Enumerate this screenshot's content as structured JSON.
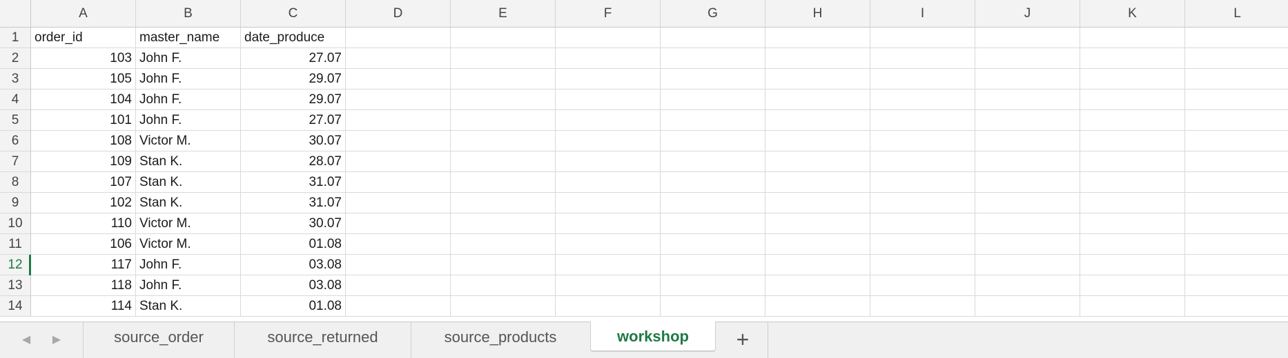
{
  "columns": [
    "A",
    "B",
    "C",
    "D",
    "E",
    "F",
    "G",
    "H",
    "I",
    "J",
    "K",
    "L"
  ],
  "rows": [
    {
      "n": "1",
      "a": "order_id",
      "b": "master_name",
      "c": "date_produce",
      "header": true
    },
    {
      "n": "2",
      "a": "103",
      "b": "John F.",
      "c": "27.07"
    },
    {
      "n": "3",
      "a": "105",
      "b": "John F.",
      "c": "29.07"
    },
    {
      "n": "4",
      "a": "104",
      "b": "John F.",
      "c": "29.07"
    },
    {
      "n": "5",
      "a": "101",
      "b": "John F.",
      "c": "27.07"
    },
    {
      "n": "6",
      "a": "108",
      "b": "Victor M.",
      "c": "30.07"
    },
    {
      "n": "7",
      "a": "109",
      "b": "Stan K.",
      "c": "28.07"
    },
    {
      "n": "8",
      "a": "107",
      "b": "Stan K.",
      "c": "31.07"
    },
    {
      "n": "9",
      "a": "102",
      "b": "Stan K.",
      "c": "31.07"
    },
    {
      "n": "10",
      "a": "110",
      "b": "Victor M.",
      "c": "30.07"
    },
    {
      "n": "11",
      "a": "106",
      "b": "Victor M.",
      "c": "01.08"
    },
    {
      "n": "12",
      "a": "117",
      "b": "John F.",
      "c": "03.08",
      "active": true
    },
    {
      "n": "13",
      "a": "118",
      "b": "John F.",
      "c": "03.08"
    },
    {
      "n": "14",
      "a": "114",
      "b": "Stan K.",
      "c": "01.08"
    }
  ],
  "tabs": [
    {
      "label": "source_order"
    },
    {
      "label": "source_returned"
    },
    {
      "label": "source_products"
    },
    {
      "label": "workshop",
      "active": true
    }
  ],
  "icons": {
    "prev": "chevron-left-icon",
    "next": "chevron-right-icon",
    "add": "plus-icon"
  },
  "colors": {
    "accent": "#1e7a44",
    "header_bg": "#f3f3f3",
    "grid": "#d9d9d9"
  }
}
